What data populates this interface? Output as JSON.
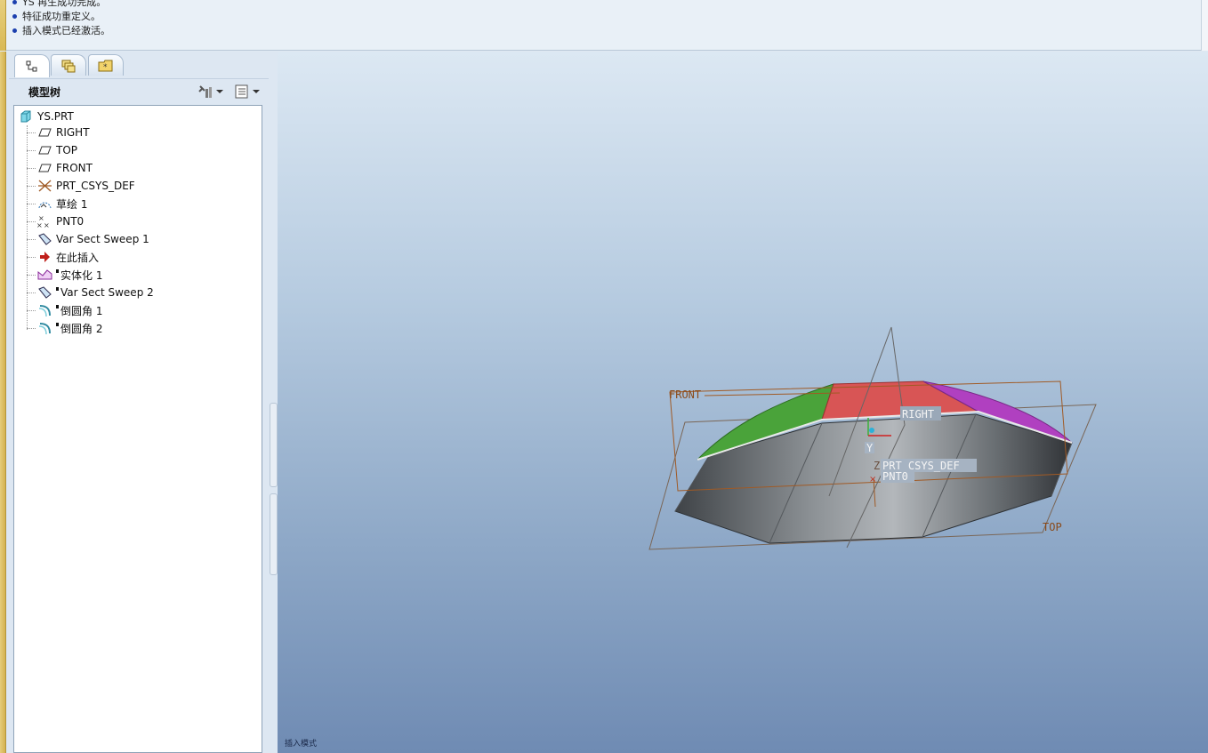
{
  "messages": [
    "YS 再生成功完成。",
    "特征成功重定义。",
    "插入模式已经激活。"
  ],
  "navigator": {
    "tabs": [
      "model-tree-tab",
      "layers-tab",
      "favorites-tab"
    ],
    "title": "模型树"
  },
  "tree": {
    "root": "YS.PRT",
    "items": [
      {
        "label": "RIGHT",
        "icon": "datum-plane-icon",
        "flag": false
      },
      {
        "label": "TOP",
        "icon": "datum-plane-icon",
        "flag": false
      },
      {
        "label": "FRONT",
        "icon": "datum-plane-icon",
        "flag": false
      },
      {
        "label": "PRT_CSYS_DEF",
        "icon": "coordinate-system-icon",
        "flag": false
      },
      {
        "label": "草绘 1",
        "icon": "sketch-icon",
        "flag": false
      },
      {
        "label": "PNT0",
        "icon": "datum-point-icon",
        "flag": false
      },
      {
        "label": "Var Sect Sweep 1",
        "icon": "sweep-icon",
        "flag": false
      },
      {
        "label": "在此插入",
        "icon": "insert-here-arrow-icon",
        "flag": false
      },
      {
        "label": "实体化 1",
        "icon": "solidify-icon",
        "flag": true
      },
      {
        "label": "Var Sect Sweep 2",
        "icon": "sweep-icon",
        "flag": true
      },
      {
        "label": "倒圆角 1",
        "icon": "round-icon",
        "flag": true
      },
      {
        "label": "倒圆角 2",
        "icon": "round-icon",
        "flag": true
      }
    ]
  },
  "viewport": {
    "labels": {
      "front": "FRONT",
      "right": "RIGHT",
      "top": "TOP",
      "csys": "PRT_CSYS_DEF",
      "pnt": "PNT0",
      "csys_z": "Z",
      "y_tag": "Y"
    },
    "mode_text": "插入模式",
    "colors": {
      "green_face": "#4aa33a",
      "red_face": "#d85555",
      "magenta_face": "#b040c0",
      "datum": "#a05a25"
    }
  }
}
